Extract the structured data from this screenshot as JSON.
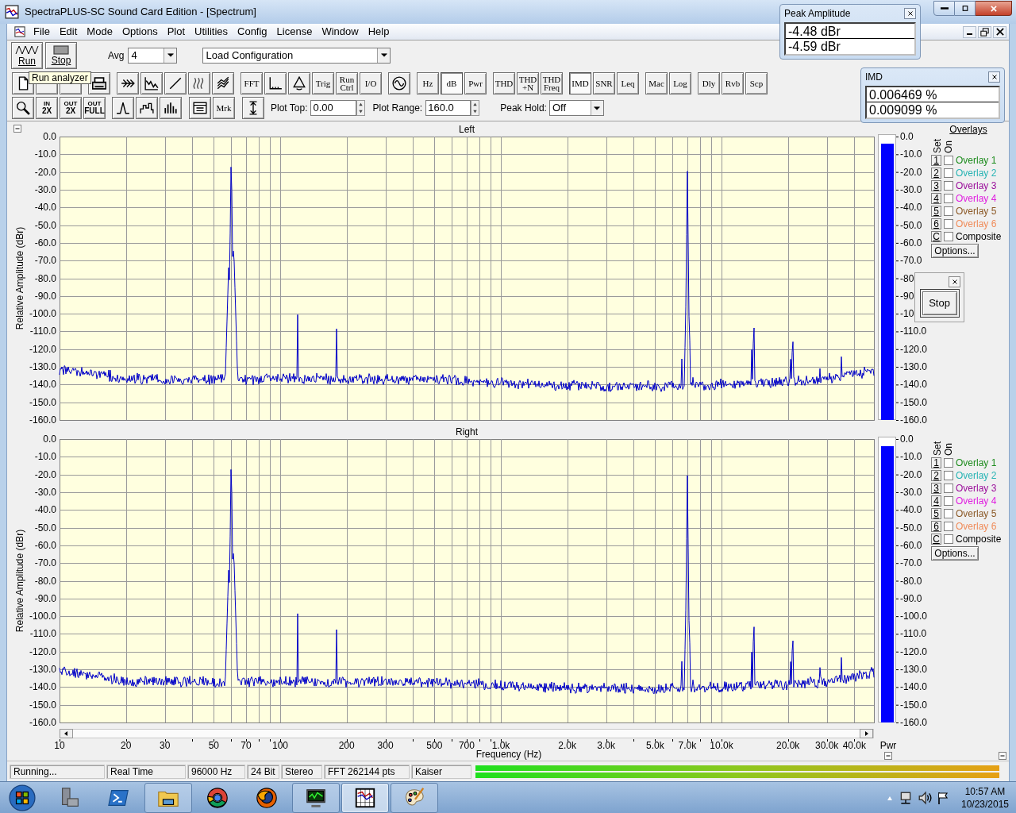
{
  "window": {
    "title": "SpectraPLUS-SC Sound Card Edition - [Spectrum]"
  },
  "menu": [
    "File",
    "Edit",
    "Mode",
    "Options",
    "Plot",
    "Utilities",
    "Config",
    "License",
    "Window",
    "Help"
  ],
  "transport": [
    {
      "kind": "run",
      "label": "Run"
    },
    {
      "kind": "stop",
      "label": "Stop"
    }
  ],
  "avg": {
    "label": "Avg",
    "value": "4"
  },
  "configuration": {
    "value": "Load Configuration"
  },
  "tooltip": "Run analyzer",
  "toolbar_buttons": [
    {
      "label": "FFT",
      "selected": false
    },
    {
      "label": "Trig",
      "selected": false
    },
    {
      "label": "Run Ctrl",
      "selected": false
    },
    {
      "label": "I/O",
      "selected": false
    },
    {
      "label": "Hz",
      "selected": false
    },
    {
      "label": "dB",
      "selected": true
    },
    {
      "label": "Pwr",
      "selected": false
    },
    {
      "label": "THD",
      "selected": false
    },
    {
      "label": "THD +N",
      "selected": false
    },
    {
      "label": "THD Freq",
      "selected": false
    },
    {
      "label": "IMD",
      "selected": true
    },
    {
      "label": "SNR",
      "selected": false
    },
    {
      "label": "Leq",
      "selected": false
    },
    {
      "label": "Mac",
      "selected": false
    },
    {
      "label": "Log",
      "selected": false
    },
    {
      "label": "Dly",
      "selected": false
    },
    {
      "label": "Rvb",
      "selected": false
    },
    {
      "label": "Scp",
      "selected": false
    }
  ],
  "zoom_buttons": [
    {
      "top": "IN",
      "bottom": "2X"
    },
    {
      "top": "OUT",
      "bottom": "2X"
    },
    {
      "top": "OUT",
      "bottom": "FULL"
    }
  ],
  "marker_button": "Mrk",
  "plot_top": {
    "label": "Plot Top:",
    "value": "0.00"
  },
  "plot_range": {
    "label": "Plot Range:",
    "value": "160.0"
  },
  "peak_hold": {
    "label": "Peak Hold:",
    "value": "Off"
  },
  "channels": [
    {
      "title": "Left",
      "ylabel": "Relative Amplitude (dBr)",
      "yticks": [
        "0.0",
        "-10.0",
        "-20.0",
        "-30.0",
        "-40.0",
        "-50.0",
        "-60.0",
        "-70.0",
        "-80.0",
        "-90.0",
        "-100.0",
        "-110.0",
        "-120.0",
        "-130.0",
        "-140.0",
        "-150.0",
        "-160.0"
      ],
      "meter": {
        "level": 0.975,
        "ticks": [
          "0.0",
          "-10.0",
          "-20.0",
          "-30.0",
          "-40.0",
          "-50.0",
          "-60.0",
          "-70.0",
          "-80",
          "-90",
          "-10",
          "-110.0",
          "-120.0",
          "-130.0",
          "-140.0",
          "-150.0",
          "-160.0"
        ]
      },
      "overlays": {
        "title": "Overlays",
        "set_label": "Set",
        "on_label": "On",
        "options": "Options...",
        "items": [
          {
            "set": "1",
            "label": "Overlay 1",
            "color": "#1e8c1e",
            "checked": false
          },
          {
            "set": "2",
            "label": "Overlay 2",
            "color": "#28b4b4",
            "checked": false
          },
          {
            "set": "3",
            "label": "Overlay 3",
            "color": "#9b109b",
            "checked": false
          },
          {
            "set": "4",
            "label": "Overlay 4",
            "color": "#e020e0",
            "checked": false
          },
          {
            "set": "5",
            "label": "Overlay 5",
            "color": "#8c5a28",
            "checked": false
          },
          {
            "set": "6",
            "label": "Overlay 6",
            "color": "#f08c5a",
            "checked": false
          },
          {
            "set": "C",
            "label": "Composite",
            "color": "#000000",
            "checked": false
          }
        ]
      }
    },
    {
      "title": "Right",
      "ylabel": "Relative Amplitude (dBr)",
      "yticks": [
        "0.0",
        "-10.0",
        "-20.0",
        "-30.0",
        "-40.0",
        "-50.0",
        "-60.0",
        "-70.0",
        "-80.0",
        "-90.0",
        "-100.0",
        "-110.0",
        "-120.0",
        "-130.0",
        "-140.0",
        "-150.0",
        "-160.0"
      ],
      "meter": {
        "level": 0.975,
        "ticks": [
          "0.0",
          "-10.0",
          "-20.0",
          "-30.0",
          "-40.0",
          "-50.0",
          "-60.0",
          "-70.0",
          "-80.0",
          "-90.0",
          "-100.0",
          "-110.0",
          "-120.0",
          "-130.0",
          "-140.0",
          "-150.0",
          "-160.0"
        ]
      },
      "overlays": {
        "set_label": "Set",
        "on_label": "On",
        "options": "Options...",
        "items": [
          {
            "set": "1",
            "label": "Overlay 1",
            "color": "#1e8c1e",
            "checked": false
          },
          {
            "set": "2",
            "label": "Overlay 2",
            "color": "#28b4b4",
            "checked": false
          },
          {
            "set": "3",
            "label": "Overlay 3",
            "color": "#9b109b",
            "checked": false
          },
          {
            "set": "4",
            "label": "Overlay 4",
            "color": "#e020e0",
            "checked": false
          },
          {
            "set": "5",
            "label": "Overlay 5",
            "color": "#8c5a28",
            "checked": false
          },
          {
            "set": "6",
            "label": "Overlay 6",
            "color": "#f08c5a",
            "checked": false
          },
          {
            "set": "C",
            "label": "Composite",
            "color": "#000000",
            "checked": false
          }
        ]
      }
    }
  ],
  "xticks": [
    "10",
    "20",
    "30",
    "50",
    "70",
    "100",
    "200",
    "300",
    "500",
    "700",
    "1.0k",
    "2.0k",
    "3.0k",
    "5.0k",
    "7.0k",
    "10.0k",
    "20.0k",
    "30.0k",
    "40.0k"
  ],
  "xlabel": "Frequency (Hz)",
  "meter_label": "Pwr",
  "peak_amplitude": {
    "title": "Peak Amplitude",
    "values": [
      "-4.48 dBr",
      "-4.59 dBr"
    ]
  },
  "imd": {
    "title": "IMD",
    "values": [
      "0.006469 %",
      "0.009099 %"
    ]
  },
  "stop_window": {
    "button": "Stop"
  },
  "status_bar": [
    "Running...",
    "Real Time",
    "96000 Hz",
    "24 Bit",
    "Stereo",
    "FFT 262144 pts",
    "Kaiser"
  ],
  "input_level": [
    {
      "level": 1
    },
    {
      "level": 1
    }
  ],
  "taskbar": [
    {
      "kind": "start",
      "running": false,
      "selected": false
    },
    {
      "kind": "server",
      "running": false,
      "selected": false
    },
    {
      "kind": "shell",
      "running": false,
      "selected": false
    },
    {
      "kind": "folder",
      "running": true,
      "selected": false
    },
    {
      "kind": "chrome",
      "running": false,
      "selected": false
    },
    {
      "kind": "firefox",
      "running": false,
      "selected": false
    },
    {
      "kind": "monitor",
      "running": true,
      "selected": false
    },
    {
      "kind": "spectra",
      "running": true,
      "selected": true
    },
    {
      "kind": "paint",
      "running": true,
      "selected": false
    }
  ],
  "clock": {
    "time": "10:57 AM",
    "date": "10/23/2015"
  }
}
